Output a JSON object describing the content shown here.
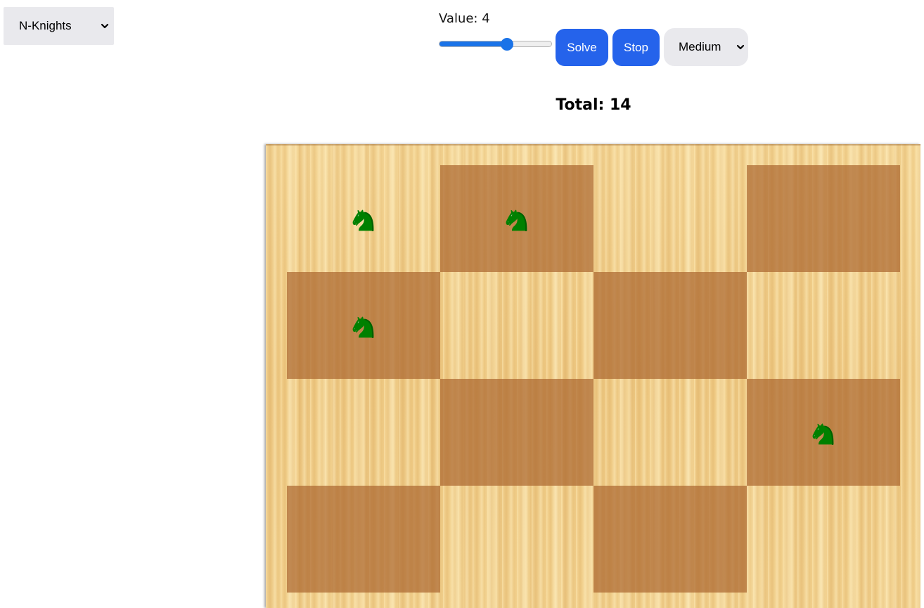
{
  "puzzle_select": {
    "selected": "N-Knights",
    "icon": "chevron-down-icon"
  },
  "controls": {
    "value_label": "Value: 4",
    "slider_fraction": 0.6,
    "solve_label": "Solve",
    "stop_label": "Stop",
    "difficulty_selected": "Medium"
  },
  "total_label": "Total: 14",
  "board": {
    "rows": 4,
    "cols": 4,
    "piece": "knight-icon",
    "piece_color": "#008000",
    "light_color": "#f0cd8a",
    "dark_color": "#b76c2f",
    "knights": [
      {
        "row": 0,
        "col": 0
      },
      {
        "row": 0,
        "col": 1
      },
      {
        "row": 1,
        "col": 0
      },
      {
        "row": 2,
        "col": 3
      }
    ]
  },
  "colors": {
    "accent": "#2563eb",
    "select_bg": "#e9e9ed"
  }
}
